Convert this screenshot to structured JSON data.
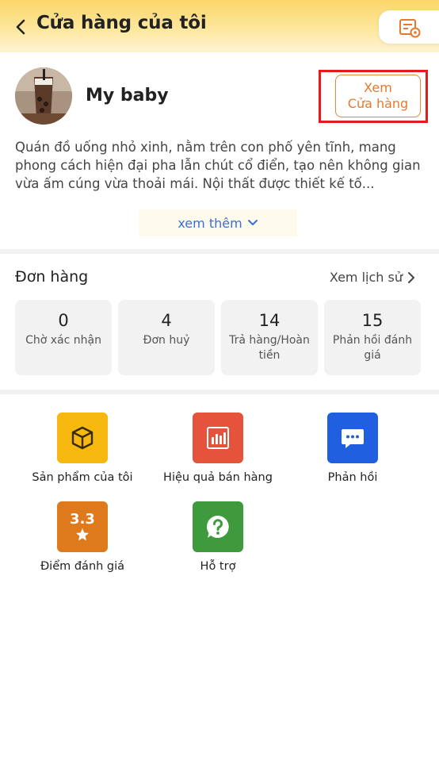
{
  "header": {
    "title": "Cửa hàng của tôi"
  },
  "shop": {
    "name": "My baby",
    "view_button_line1": "Xem",
    "view_button_line2": "Cửa hàng",
    "description": "Quán đồ uống nhỏ xinh, nằm trên con phố yên tĩnh, mang phong cách hiện đại pha lẫn chút cổ điển, tạo nên không gian vừa ấm cúng vừa thoải mái. Nội thất được thiết kế tố...",
    "see_more": "xem thêm"
  },
  "orders": {
    "title": "Đơn hàng",
    "history_link": "Xem lịch sử",
    "stats": [
      {
        "value": "0",
        "label": "Chờ xác nhận"
      },
      {
        "value": "4",
        "label": "Đơn huỷ"
      },
      {
        "value": "14",
        "label": "Trả hàng/Hoàn tiền"
      },
      {
        "value": "15",
        "label": "Phản hồi đánh giá"
      }
    ]
  },
  "features": [
    {
      "label": "Sản phẩm của tôi",
      "icon": "box-icon",
      "color": "#f7b90f"
    },
    {
      "label": "Hiệu quả bán hàng",
      "icon": "bar-chart-icon",
      "color": "#e5533d"
    },
    {
      "label": "Phản hồi",
      "icon": "chat-bubble-icon",
      "color": "#1f5fe0"
    },
    {
      "label": "Điểm đánh giá",
      "icon": "rating-star-icon",
      "rating": "3.3",
      "color": "#de7a1c"
    },
    {
      "label": "Hỗ trợ",
      "icon": "help-icon",
      "color": "#3e9a3c"
    }
  ]
}
